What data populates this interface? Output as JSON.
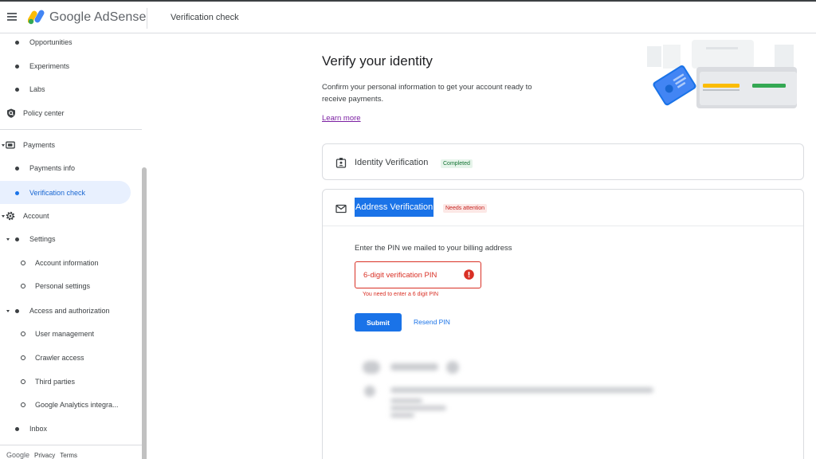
{
  "header": {
    "brand": "Google AdSense",
    "page_title": "Verification check"
  },
  "sidebar": {
    "items": [
      {
        "label": "Opportunities"
      },
      {
        "label": "Experiments"
      },
      {
        "label": "Labs"
      },
      {
        "label": "Policy center"
      },
      {
        "label": "Payments"
      },
      {
        "label": "Payments info"
      },
      {
        "label": "Verification check"
      },
      {
        "label": "Account"
      },
      {
        "label": "Settings"
      },
      {
        "label": "Account information"
      },
      {
        "label": "Personal settings"
      },
      {
        "label": "Access and authorization"
      },
      {
        "label": "User management"
      },
      {
        "label": "Crawler access"
      },
      {
        "label": "Third parties"
      },
      {
        "label": "Google Analytics integra..."
      },
      {
        "label": "Inbox"
      }
    ],
    "footer": {
      "google": "Google",
      "privacy": "Privacy",
      "terms": "Terms"
    }
  },
  "main": {
    "title": "Verify your identity",
    "description": "Confirm your personal information to get your account ready to receive payments.",
    "learn_more": "Learn more",
    "identity_card": {
      "title": "Identity Verification",
      "badge": "Completed"
    },
    "address_card": {
      "title": "Address Verification",
      "badge": "Needs attention",
      "pin_label": "Enter the PIN we mailed to your billing address",
      "pin_placeholder": "6-digit verification PIN",
      "pin_value": "",
      "error": "You need to enter a 6 digit PIN",
      "submit": "Submit",
      "resend": "Resend PIN"
    }
  },
  "colors": {
    "accent": "#1a73e8",
    "error": "#d93025",
    "success_bg": "#e6f4ea",
    "active_nav_bg": "#e8f0fe"
  }
}
